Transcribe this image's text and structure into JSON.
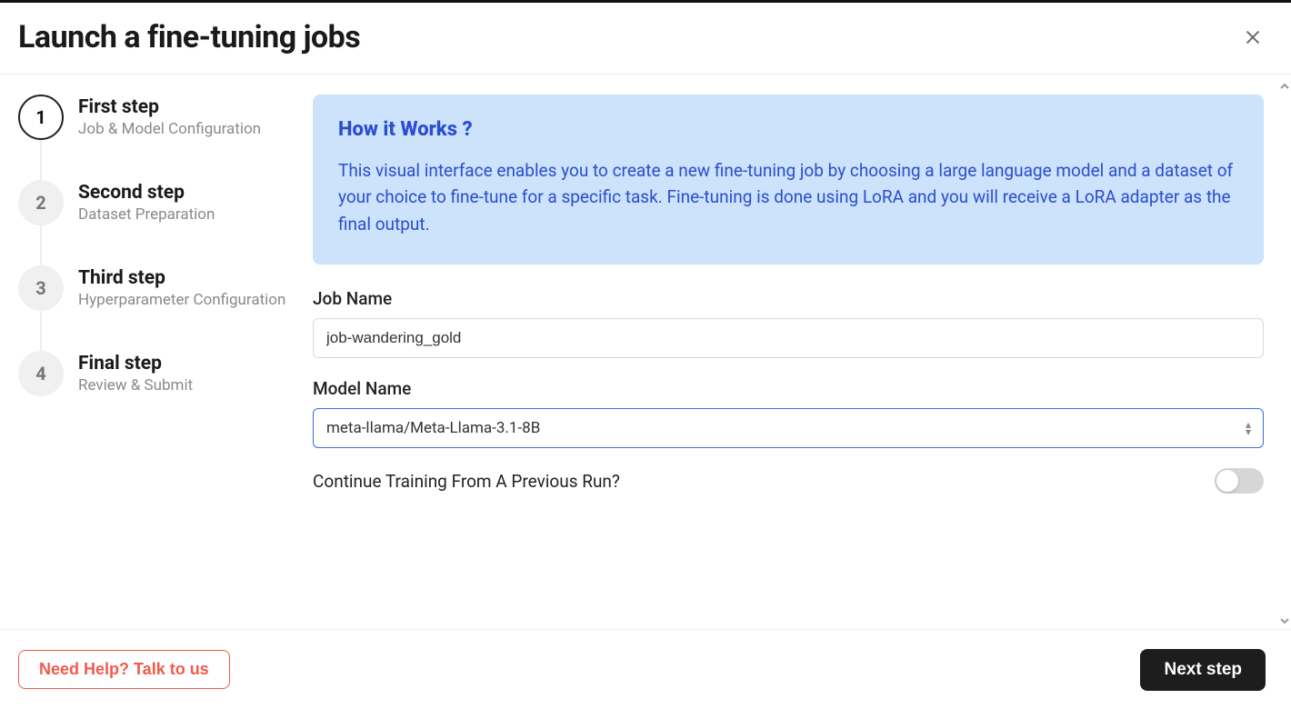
{
  "header": {
    "title": "Launch a fine-tuning jobs"
  },
  "stepper": {
    "steps": [
      {
        "num": "1",
        "title": "First step",
        "sub": "Job & Model Configuration"
      },
      {
        "num": "2",
        "title": "Second step",
        "sub": "Dataset Preparation"
      },
      {
        "num": "3",
        "title": "Third step",
        "sub": "Hyperparameter Configuration"
      },
      {
        "num": "4",
        "title": "Final step",
        "sub": "Review & Submit"
      }
    ]
  },
  "info": {
    "title": "How it Works ?",
    "body": "This visual interface enables you to create a new fine-tuning job by choosing a large language model and a dataset of your choice to fine-tune for a specific task. Fine-tuning is done using LoRA and you will receive a LoRA adapter as the final output."
  },
  "form": {
    "job_name_label": "Job Name",
    "job_name_value": "job-wandering_gold",
    "model_name_label": "Model Name",
    "model_name_value": "meta-llama/Meta-Llama-3.1-8B",
    "continue_label": "Continue Training From A Previous Run?",
    "continue_value": false
  },
  "footer": {
    "help_label": "Need Help? Talk to us",
    "next_label": "Next step"
  }
}
